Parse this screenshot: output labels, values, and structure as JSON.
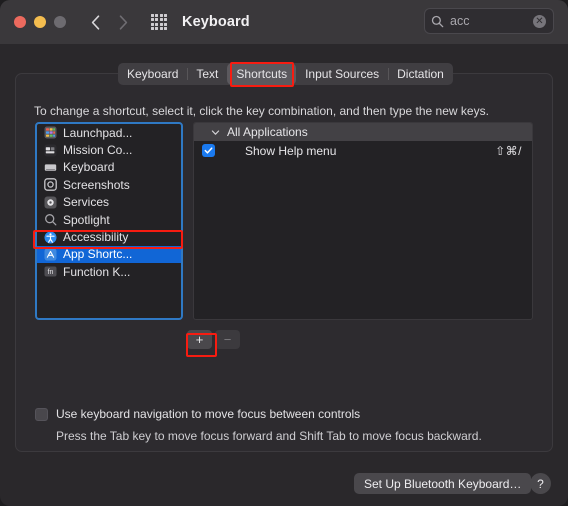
{
  "window": {
    "title": "Keyboard",
    "traffic_lights": [
      "close-red",
      "minimize-yellow",
      "zoom-grey"
    ],
    "back_icon": "chevron-left-icon",
    "forward_icon": "chevron-right-icon",
    "grid_icon": "grid-view-icon"
  },
  "search": {
    "icon": "search-icon",
    "value": "acc",
    "placeholder": "Search",
    "clear_icon": "clear-circle-icon",
    "clear_glyph": "✕"
  },
  "tabs": [
    {
      "label": "Keyboard",
      "active": false
    },
    {
      "label": "Text",
      "active": false
    },
    {
      "label": "Shortcuts",
      "active": true
    },
    {
      "label": "Input Sources",
      "active": false
    },
    {
      "label": "Dictation",
      "active": false
    }
  ],
  "panel": {
    "hint": "To change a shortcut, select it, click the key combination, and then type the new keys."
  },
  "sidebar": {
    "items": [
      {
        "label": "Launchpad...",
        "icon": "launchpad-icon",
        "selected": false
      },
      {
        "label": "Mission Co...",
        "icon": "mission-control-icon",
        "selected": false
      },
      {
        "label": "Keyboard",
        "icon": "keyboard-icon",
        "selected": false
      },
      {
        "label": "Screenshots",
        "icon": "screenshots-icon",
        "selected": false
      },
      {
        "label": "Services",
        "icon": "services-gear-icon",
        "selected": false
      },
      {
        "label": "Spotlight",
        "icon": "spotlight-search-icon",
        "selected": false
      },
      {
        "label": "Accessibility",
        "icon": "accessibility-icon",
        "selected": false
      },
      {
        "label": "App Shortc...",
        "icon": "app-shortcuts-icon",
        "selected": true
      },
      {
        "label": "Function K...",
        "icon": "function-keys-fn-icon",
        "selected": false
      }
    ]
  },
  "shortcut_list": {
    "group": {
      "label": "All Applications",
      "disclosure_icon": "chevron-down-icon",
      "expanded": true
    },
    "rows": [
      {
        "checked": true,
        "name": "Show Help menu",
        "keys": "⇧⌘/",
        "checkmark": "✓"
      }
    ]
  },
  "list_controls": {
    "add_label": "+",
    "remove_label": "−",
    "add_enabled": true,
    "remove_enabled": false
  },
  "keyboard_nav": {
    "checked": false,
    "label": "Use keyboard navigation to move focus between controls",
    "sublabel": "Press the Tab key to move focus forward and Shift Tab to move focus backward."
  },
  "footer": {
    "bluetooth_button": "Set Up Bluetooth Keyboard…",
    "help_button": "?"
  },
  "colors": {
    "accent_blue": "#1166d6",
    "focus_ring": "#2f79c4",
    "annotation_red": "#f71c11",
    "checkbox_blue": "#1a7af0"
  }
}
